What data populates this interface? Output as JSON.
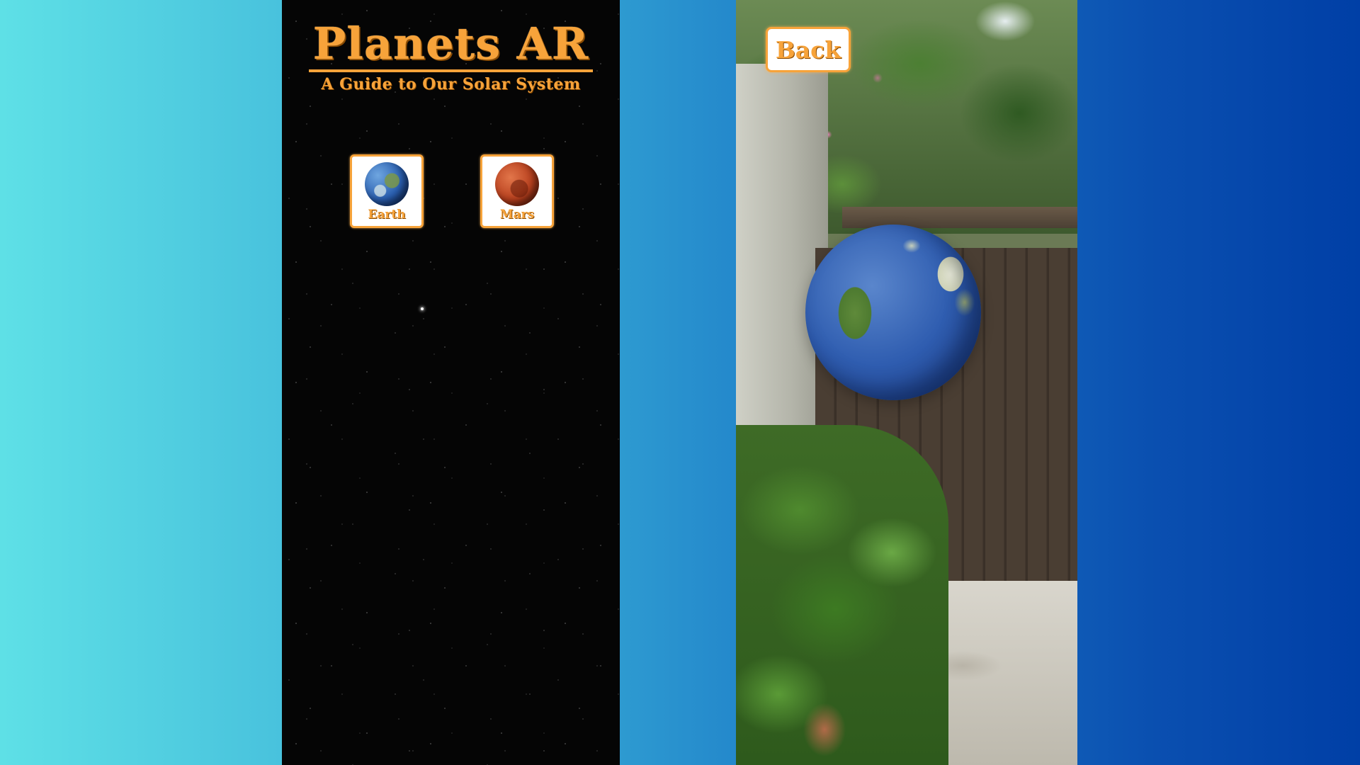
{
  "menu_screen": {
    "title": "Planets AR",
    "subtitle": "A Guide to Our Solar System",
    "planets": [
      {
        "label": "Earth",
        "icon": "earth-icon"
      },
      {
        "label": "Mars",
        "icon": "mars-icon"
      }
    ]
  },
  "ar_screen": {
    "back_label": "Back",
    "model": "earth-globe"
  },
  "colors": {
    "accent_orange": "#f7a33a",
    "button_bg": "#ffffff",
    "menu_bg": "#050505",
    "backdrop_left": "#5ee0e6",
    "backdrop_right": "#003fa6"
  }
}
